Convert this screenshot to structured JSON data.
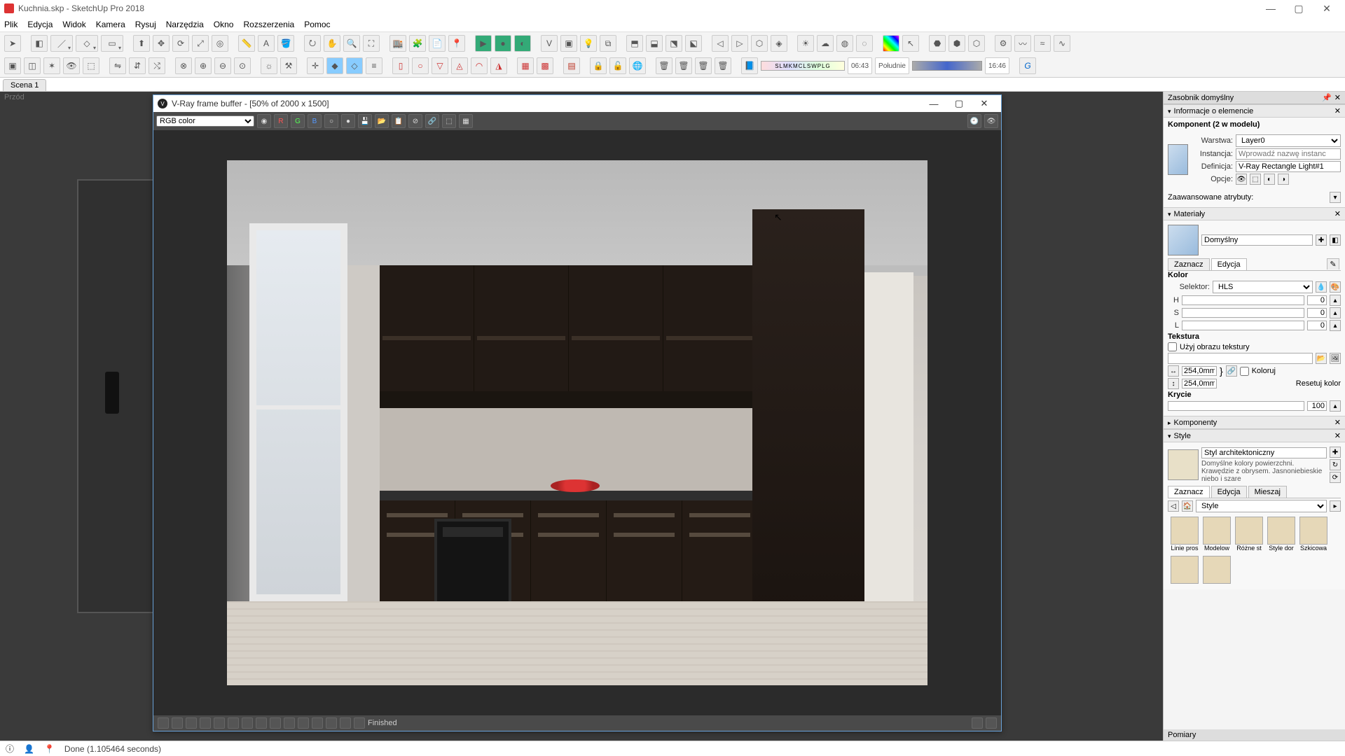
{
  "titleBar": {
    "text": "Kuchnia.skp - SketchUp Pro 2018"
  },
  "menu": [
    "Plik",
    "Edycja",
    "Widok",
    "Kamera",
    "Rysuj",
    "Narzędzia",
    "Okno",
    "Rozszerzenia",
    "Pomoc"
  ],
  "sceneTab": "Scena 1",
  "viewportLabel": "Przód",
  "vfb": {
    "title": "V-Ray frame buffer - [50% of 2000 x 1500]",
    "channel": "RGB color",
    "rgb": {
      "r": "R",
      "g": "G",
      "b": "B"
    },
    "status": "Finished"
  },
  "tray": {
    "title": "Zasobnik domyślny",
    "entityInfo": {
      "header": "Informacje o elemencie",
      "component": "Komponent (2 w modelu)",
      "layerLabel": "Warstwa:",
      "layerValue": "Layer0",
      "instanceLabel": "Instancja:",
      "instancePlaceholder": "Wprowadź nazwę instanc",
      "definitionLabel": "Definicja:",
      "definitionValue": "V-Ray Rectangle Light#1",
      "optionsLabel": "Opcje:",
      "advanced": "Zaawansowane atrybuty:"
    },
    "materials": {
      "header": "Materiały",
      "name": "Domyślny",
      "tabSelect": "Zaznacz",
      "tabEdit": "Edycja",
      "colorHeader": "Kolor",
      "selectorLabel": "Selektor:",
      "selectorValue": "HLS",
      "h": "H",
      "s": "S",
      "l": "L",
      "hVal": "0",
      "sVal": "0",
      "lVal": "0",
      "textureHeader": "Tekstura",
      "useTexture": "Użyj obrazu tekstury",
      "dim": "254,0mm",
      "colorize": "Koloruj",
      "reset": "Resetuj kolor",
      "opacityHeader": "Krycie",
      "opacityVal": "100"
    },
    "components": {
      "header": "Komponenty"
    },
    "styles": {
      "header": "Style",
      "name": "Styl architektoniczny",
      "desc": "Domyślne kolory powierzchni. Krawędzie z obrysem. Jasnoniebieskie niebo i szare",
      "tabSelect": "Zaznacz",
      "tabEdit": "Edycja",
      "tabMix": "Mieszaj",
      "dropdown": "Style",
      "thumbs": [
        "Linie pros",
        "Modelow",
        "Różne st",
        "Style dor",
        "Szkicowa"
      ]
    },
    "measure": "Pomiary"
  },
  "statusBar": {
    "message": "Done (1.105464 seconds)"
  },
  "shadow": {
    "label": "SLMKMCLSWPLG",
    "t1": "06:43",
    "noon": "Południe",
    "t2": "16:46"
  }
}
